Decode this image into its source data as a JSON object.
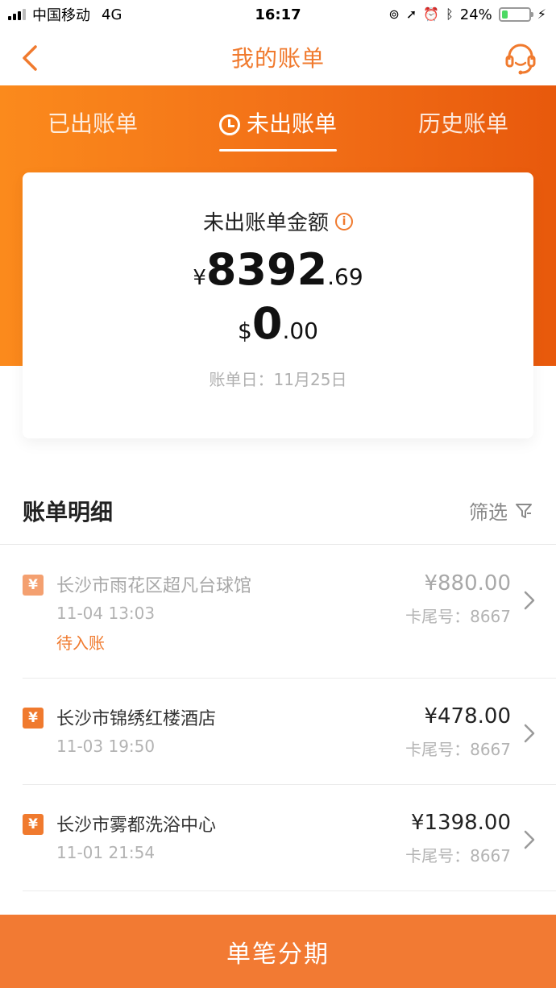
{
  "status_bar": {
    "carrier": "中国移动",
    "network": "4G",
    "time": "16:17",
    "battery": "24%",
    "battery_level": 0.24
  },
  "nav": {
    "title": "我的账单",
    "back_icon": "chevron-left-icon",
    "service_icon": "headset-icon"
  },
  "tabs": [
    {
      "label": "已出账单",
      "active": false
    },
    {
      "label": "未出账单",
      "active": true
    },
    {
      "label": "历史账单",
      "active": false
    }
  ],
  "summary": {
    "title": "未出账单金额",
    "cny_symbol": "¥",
    "cny_int": "8392",
    "cny_dec": ".69",
    "usd_symbol": "$",
    "usd_int": "0",
    "usd_dec": ".00",
    "bill_date": "账单日：11月25日"
  },
  "details": {
    "title": "账单明细",
    "filter_label": "筛选"
  },
  "transactions": [
    {
      "merchant": "长沙市雨花区超凡台球馆",
      "time": "11-04 13:03",
      "status": "待入账",
      "amount": "¥880.00",
      "card": "卡尾号：8667",
      "pending": true
    },
    {
      "merchant": "长沙市锦绣红楼酒店",
      "time": "11-03 19:50",
      "amount": "¥478.00",
      "card": "卡尾号：8667",
      "pending": false
    },
    {
      "merchant": "长沙市雾都洗浴中心",
      "time": "11-01 21:54",
      "amount": "¥1398.00",
      "card": "卡尾号：8667",
      "pending": false
    }
  ],
  "tx_icon_glyph": "¥",
  "bottom_button": {
    "label": "单笔分期"
  },
  "colors": {
    "accent": "#f07a2e",
    "header_gradient_start": "#fb8a1c",
    "header_gradient_end": "#e8590c",
    "bottom_button": "#f27a33"
  }
}
